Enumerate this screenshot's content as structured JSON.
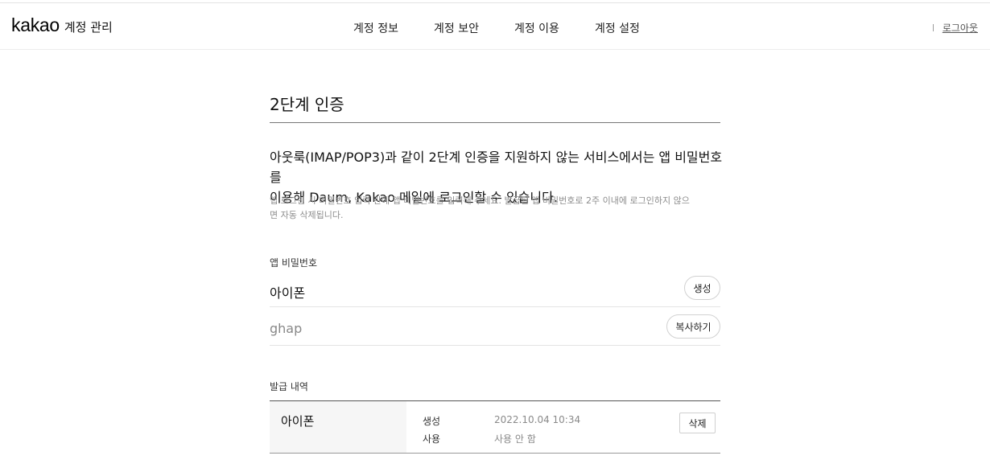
{
  "header": {
    "logo_text": "kakao",
    "logo_subtitle": "계정 관리",
    "nav": [
      "계정 정보",
      "계정 보안",
      "계정 이용",
      "계정 설정"
    ],
    "logout_label": "로그아웃"
  },
  "page": {
    "title": "2단계 인증",
    "description_line1": "아웃룩(IMAP/POP3)과 같이 2단계 인증을 지원하지 않는 서비스에서는 앱 비밀번호를",
    "description_line2": "이용해 Daum, Kakao 메일에 로그인할 수 있습니다.",
    "notice_line1": "앱 로그인 시 비밀번호 입력 란에 앱 비밀번호를 입력해 주세요. 발급된 앱 비밀번호로 2주 이내에 로그인하지 않으",
    "notice_line2": "면 자동 삭제됩니다."
  },
  "app_password": {
    "label": "앱 비밀번호",
    "name_value": "아이폰",
    "generate_label": "생성",
    "password_value": "ghap",
    "copy_label": "복사하기"
  },
  "history": {
    "label": "발급 내역",
    "rows": [
      {
        "name": "아이폰",
        "created_key": "생성",
        "created_value": "2022.10.04 10:34",
        "used_key": "사용",
        "used_value": "사용 안 함",
        "delete_label": "삭제"
      }
    ]
  }
}
